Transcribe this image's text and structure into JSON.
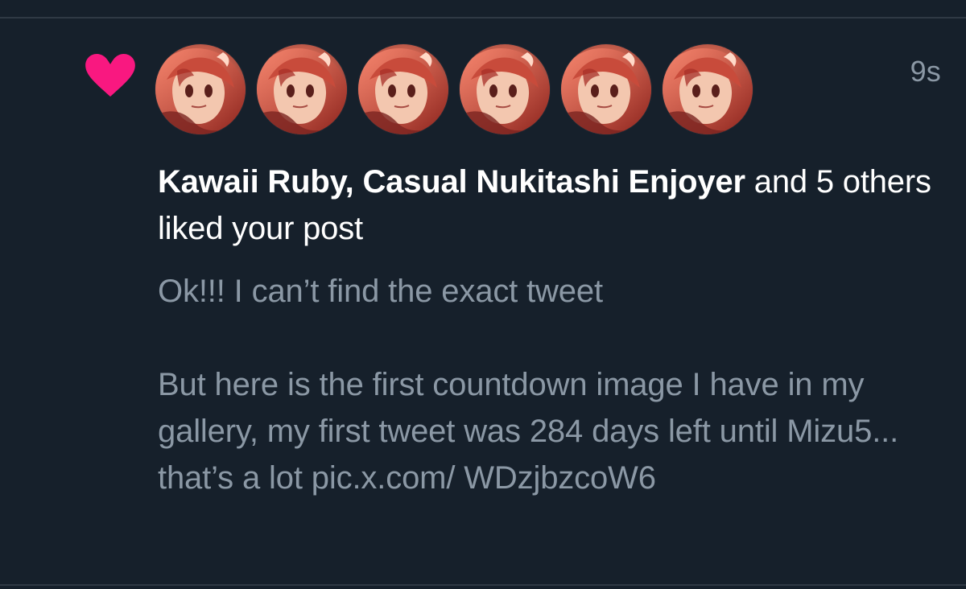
{
  "notification": {
    "type_icon": "heart-icon",
    "accent": "#f91880",
    "time": "9s",
    "avatars": [
      {
        "name": "avatar-icon"
      },
      {
        "name": "avatar-icon"
      },
      {
        "name": "avatar-icon"
      },
      {
        "name": "avatar-icon"
      },
      {
        "name": "avatar-icon"
      },
      {
        "name": "avatar-icon"
      }
    ],
    "names": "Kawaii Ruby, Casual Nukitashi Enjoyer",
    "and_text": " and ",
    "others_text": "5 others liked your post",
    "post_text": "Ok!!! I can’t find the exact tweet\n\nBut here is the first countdown image I have in my gallery, my first tweet was 284 days left until Mizu5... that’s a lot pic.x.com/ WDzjbzcoW6"
  }
}
